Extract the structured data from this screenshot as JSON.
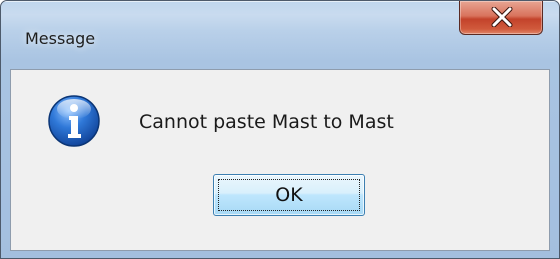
{
  "window": {
    "title": "Message",
    "close_icon": "close-x-icon"
  },
  "dialog": {
    "icon": "information-icon",
    "message": "Cannot paste Mast to Mast",
    "ok_label": "OK"
  },
  "colors": {
    "titlebar": "#b9d0e9",
    "close_button": "#c3432b",
    "client_background": "#f0f0f0",
    "ok_button": "#bee6fd",
    "info_icon": "#1f5fbf"
  }
}
